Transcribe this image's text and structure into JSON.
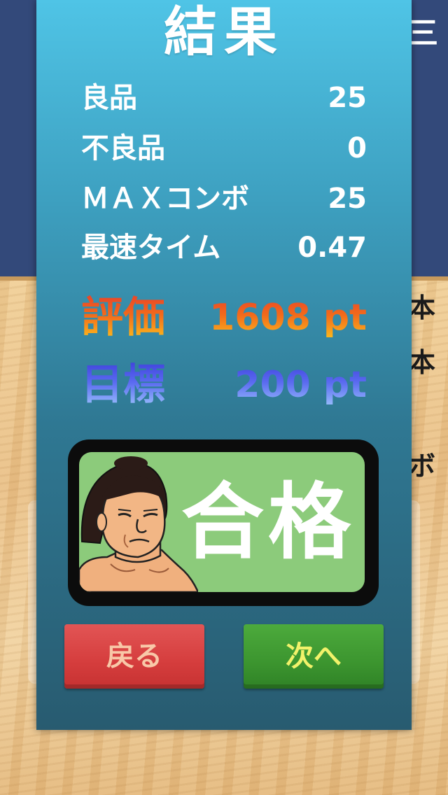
{
  "background": {
    "side_glyphs": [
      "三",
      "本",
      "本",
      "ボ"
    ]
  },
  "result": {
    "title": "結果",
    "stats": [
      {
        "label": "良品",
        "value": "25"
      },
      {
        "label": "不良品",
        "value": "0"
      },
      {
        "label": "ＭＡＸコンボ",
        "value": "25"
      },
      {
        "label": "最速タイム",
        "value": "0.47"
      }
    ],
    "evaluation": {
      "label": "評価",
      "value": "1608 pt"
    },
    "target": {
      "label": "目標",
      "value": "200 pt"
    },
    "verdict": "合格"
  },
  "buttons": {
    "back_label": "戻る",
    "next_label": "次へ"
  },
  "colors": {
    "panel_top": "#4fc4e6",
    "panel_bottom": "#285b70",
    "pass_badge": "#8ccb7b",
    "back_button": "#d53d3d",
    "next_button": "#3c952f",
    "header_band": "#33497a"
  }
}
